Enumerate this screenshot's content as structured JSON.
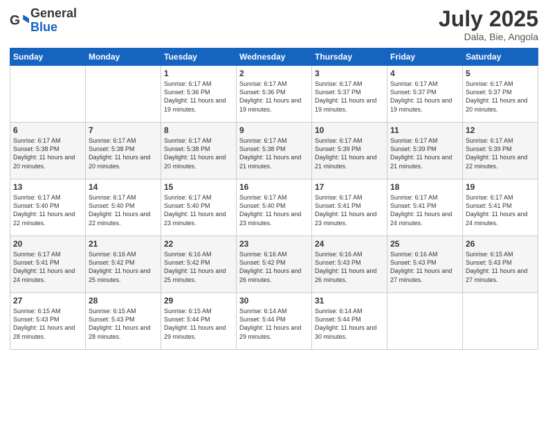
{
  "header": {
    "logo_line1": "General",
    "logo_line2": "Blue",
    "month": "July 2025",
    "location": "Dala, Bie, Angola"
  },
  "days_header": [
    "Sunday",
    "Monday",
    "Tuesday",
    "Wednesday",
    "Thursday",
    "Friday",
    "Saturday"
  ],
  "weeks": [
    [
      {
        "day": "",
        "text": ""
      },
      {
        "day": "",
        "text": ""
      },
      {
        "day": "1",
        "text": "Sunrise: 6:17 AM\nSunset: 5:36 PM\nDaylight: 11 hours and 19 minutes."
      },
      {
        "day": "2",
        "text": "Sunrise: 6:17 AM\nSunset: 5:36 PM\nDaylight: 11 hours and 19 minutes."
      },
      {
        "day": "3",
        "text": "Sunrise: 6:17 AM\nSunset: 5:37 PM\nDaylight: 11 hours and 19 minutes."
      },
      {
        "day": "4",
        "text": "Sunrise: 6:17 AM\nSunset: 5:37 PM\nDaylight: 11 hours and 19 minutes."
      },
      {
        "day": "5",
        "text": "Sunrise: 6:17 AM\nSunset: 5:37 PM\nDaylight: 11 hours and 20 minutes."
      }
    ],
    [
      {
        "day": "6",
        "text": "Sunrise: 6:17 AM\nSunset: 5:38 PM\nDaylight: 11 hours and 20 minutes."
      },
      {
        "day": "7",
        "text": "Sunrise: 6:17 AM\nSunset: 5:38 PM\nDaylight: 11 hours and 20 minutes."
      },
      {
        "day": "8",
        "text": "Sunrise: 6:17 AM\nSunset: 5:38 PM\nDaylight: 11 hours and 20 minutes."
      },
      {
        "day": "9",
        "text": "Sunrise: 6:17 AM\nSunset: 5:38 PM\nDaylight: 11 hours and 21 minutes."
      },
      {
        "day": "10",
        "text": "Sunrise: 6:17 AM\nSunset: 5:39 PM\nDaylight: 11 hours and 21 minutes."
      },
      {
        "day": "11",
        "text": "Sunrise: 6:17 AM\nSunset: 5:39 PM\nDaylight: 11 hours and 21 minutes."
      },
      {
        "day": "12",
        "text": "Sunrise: 6:17 AM\nSunset: 5:39 PM\nDaylight: 11 hours and 22 minutes."
      }
    ],
    [
      {
        "day": "13",
        "text": "Sunrise: 6:17 AM\nSunset: 5:40 PM\nDaylight: 11 hours and 22 minutes."
      },
      {
        "day": "14",
        "text": "Sunrise: 6:17 AM\nSunset: 5:40 PM\nDaylight: 11 hours and 22 minutes."
      },
      {
        "day": "15",
        "text": "Sunrise: 6:17 AM\nSunset: 5:40 PM\nDaylight: 11 hours and 23 minutes."
      },
      {
        "day": "16",
        "text": "Sunrise: 6:17 AM\nSunset: 5:40 PM\nDaylight: 11 hours and 23 minutes."
      },
      {
        "day": "17",
        "text": "Sunrise: 6:17 AM\nSunset: 5:41 PM\nDaylight: 11 hours and 23 minutes."
      },
      {
        "day": "18",
        "text": "Sunrise: 6:17 AM\nSunset: 5:41 PM\nDaylight: 11 hours and 24 minutes."
      },
      {
        "day": "19",
        "text": "Sunrise: 6:17 AM\nSunset: 5:41 PM\nDaylight: 11 hours and 24 minutes."
      }
    ],
    [
      {
        "day": "20",
        "text": "Sunrise: 6:17 AM\nSunset: 5:41 PM\nDaylight: 11 hours and 24 minutes."
      },
      {
        "day": "21",
        "text": "Sunrise: 6:16 AM\nSunset: 5:42 PM\nDaylight: 11 hours and 25 minutes."
      },
      {
        "day": "22",
        "text": "Sunrise: 6:16 AM\nSunset: 5:42 PM\nDaylight: 11 hours and 25 minutes."
      },
      {
        "day": "23",
        "text": "Sunrise: 6:16 AM\nSunset: 5:42 PM\nDaylight: 11 hours and 26 minutes."
      },
      {
        "day": "24",
        "text": "Sunrise: 6:16 AM\nSunset: 5:43 PM\nDaylight: 11 hours and 26 minutes."
      },
      {
        "day": "25",
        "text": "Sunrise: 6:16 AM\nSunset: 5:43 PM\nDaylight: 11 hours and 27 minutes."
      },
      {
        "day": "26",
        "text": "Sunrise: 6:15 AM\nSunset: 5:43 PM\nDaylight: 11 hours and 27 minutes."
      }
    ],
    [
      {
        "day": "27",
        "text": "Sunrise: 6:15 AM\nSunset: 5:43 PM\nDaylight: 11 hours and 28 minutes."
      },
      {
        "day": "28",
        "text": "Sunrise: 6:15 AM\nSunset: 5:43 PM\nDaylight: 11 hours and 28 minutes."
      },
      {
        "day": "29",
        "text": "Sunrise: 6:15 AM\nSunset: 5:44 PM\nDaylight: 11 hours and 29 minutes."
      },
      {
        "day": "30",
        "text": "Sunrise: 6:14 AM\nSunset: 5:44 PM\nDaylight: 11 hours and 29 minutes."
      },
      {
        "day": "31",
        "text": "Sunrise: 6:14 AM\nSunset: 5:44 PM\nDaylight: 11 hours and 30 minutes."
      },
      {
        "day": "",
        "text": ""
      },
      {
        "day": "",
        "text": ""
      }
    ]
  ]
}
